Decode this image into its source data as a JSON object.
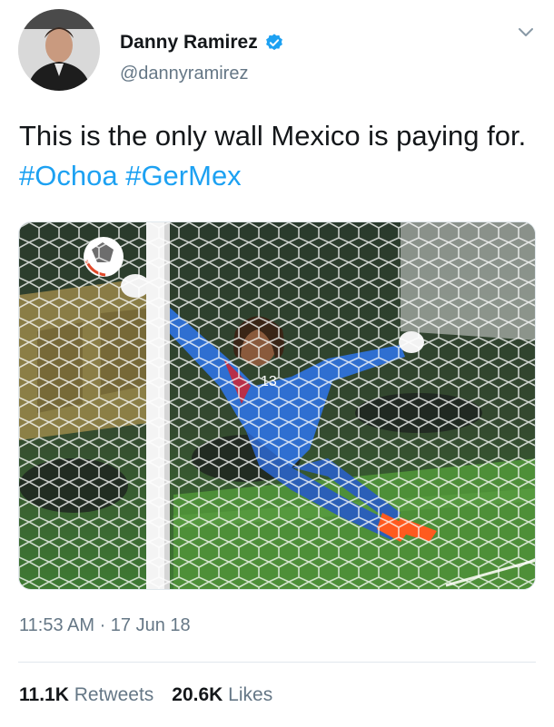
{
  "author": {
    "display_name": "Danny Ramirez",
    "handle": "@dannyramirez",
    "verified": true,
    "avatar_icon": "profile-photo"
  },
  "tweet": {
    "text_prefix": "This is the only wall Mexico is paying for.",
    "hashtags": [
      "#Ochoa",
      "#GerMex"
    ],
    "media_description_icon": "goalkeeper-photo",
    "media_jersey_number": "13"
  },
  "meta": {
    "timestamp": "11:53 AM · 17 Jun 18"
  },
  "stats": {
    "retweets_count": "11.1K",
    "retweets_label": "Retweets",
    "likes_count": "20.6K",
    "likes_label": "Likes"
  },
  "colors": {
    "link": "#1da1f2",
    "secondary_text": "#657786",
    "verified_badge": "#1da1f2",
    "primary_text": "#14171a"
  }
}
